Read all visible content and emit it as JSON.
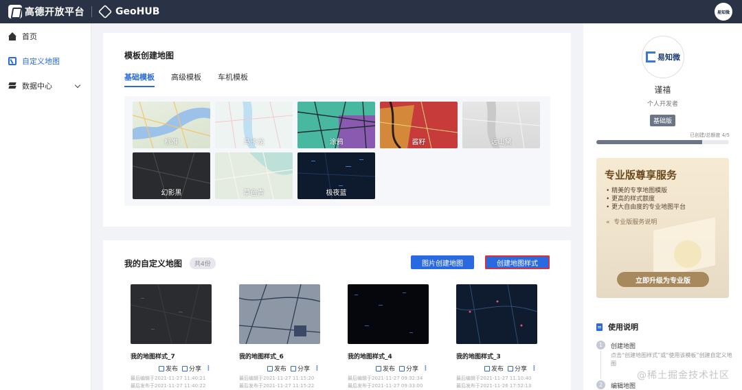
{
  "topbar": {
    "brand": "高德开放平台",
    "product": "GeoHUB",
    "avatar_text": "易知微"
  },
  "sidebar": {
    "items": [
      {
        "label": "首页",
        "icon": "home-icon"
      },
      {
        "label": "自定义地图",
        "icon": "map-icon",
        "active": true
      },
      {
        "label": "数据中心",
        "icon": "layers-icon",
        "expandable": true
      }
    ]
  },
  "templates": {
    "title": "模板创建地图",
    "tabs": [
      {
        "label": "基础模板",
        "active": true
      },
      {
        "label": "高级模板"
      },
      {
        "label": "车机模板"
      }
    ],
    "items": [
      {
        "label": "标准"
      },
      {
        "label": "马卡龙"
      },
      {
        "label": "涂鸦"
      },
      {
        "label": "酱籽"
      },
      {
        "label": "远山黛"
      },
      {
        "label": "幻影黑"
      },
      {
        "label": "草色青"
      },
      {
        "label": "极夜蓝"
      }
    ]
  },
  "my_maps": {
    "title": "我的自定义地图",
    "count_badge": "共4份",
    "btn_image_create": "图片创建地图",
    "btn_create_style": "创建地图样式",
    "publish_label": "发布",
    "share_label": "分享",
    "cards": [
      {
        "name": "我的地图样式_7",
        "edited": "最后编辑于2021-11-27 11:40:21",
        "published": "最后发布于2021-11-27 11:40:22"
      },
      {
        "name": "我的地图样式_6",
        "edited": "最后编辑于2021-11-27 11:15:20",
        "published": "最后发布于2021-11-27 11:15:22"
      },
      {
        "name": "我的地图样式_4",
        "edited": "最后编辑于2021-11-27 09:32:34",
        "published": "最后发布于2021-11-27 09:33:00"
      },
      {
        "name": "我的地图样式_3",
        "edited": "最后编辑于2021-11-27 11:10:40",
        "published": "最后发布于2021-11-26 17:52:13"
      }
    ]
  },
  "profile": {
    "logo_text": "易知微",
    "name": "谨禧",
    "role": "个人开发者",
    "tier": "基础版",
    "quota_text": "已创建/总额度  4/5",
    "quota_fraction": 0.8
  },
  "promo": {
    "title": "专业版尊享服务",
    "features": [
      "• 精美的专享地图模版",
      "• 更高的样式额度",
      "• 更大自由度的专业地图平台"
    ],
    "link": "专业版服务说明",
    "button": "立即升级为专业版"
  },
  "guide": {
    "title": "使用说明",
    "steps": [
      {
        "num": "1",
        "title": "创建地图",
        "desc": "点击“创建地图样式”或“使用该模板”创建自定义地图"
      },
      {
        "num": "2",
        "title": "编辑地图"
      }
    ]
  },
  "watermark": "@稀土掘金技术社区"
}
